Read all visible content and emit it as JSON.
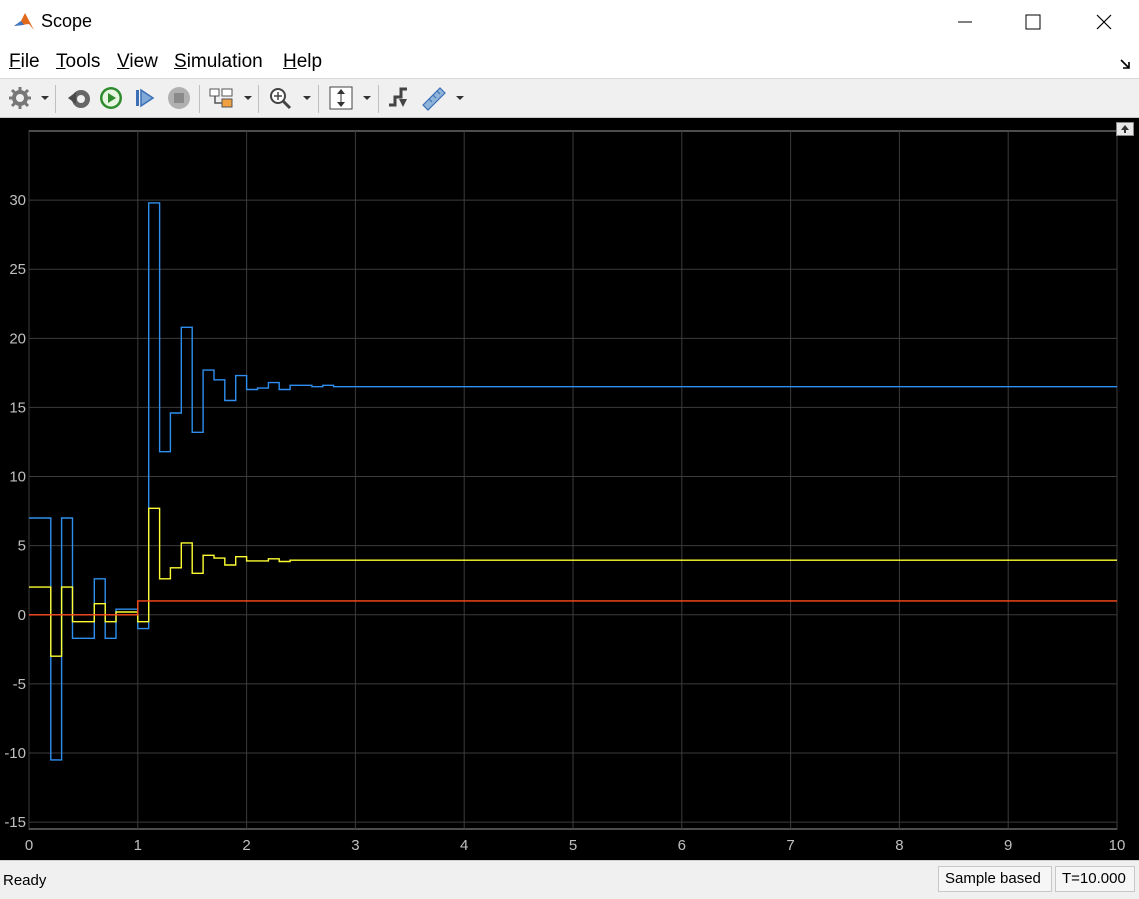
{
  "window": {
    "title": "Scope"
  },
  "menu": [
    "File",
    "Tools",
    "View",
    "Simulation",
    "Help"
  ],
  "toolbar": {
    "icons": [
      "gear-icon",
      "run-back-icon",
      "run-icon",
      "step-forward-icon",
      "stop-icon",
      "highlight-block-icon",
      "zoom-icon",
      "autoscale-icon",
      "signal-select-icon",
      "measure-icon"
    ]
  },
  "status": {
    "text": "Ready",
    "mode": "Sample based",
    "time": "T=10.000"
  },
  "colors": {
    "background": "#000000",
    "grid": "#3c3c3c",
    "axis_text": "#c0c0c0",
    "series1": "#ffff33",
    "series2": "#2e8ff0",
    "series3": "#ff4b1e"
  },
  "chart_data": {
    "type": "line",
    "step": true,
    "xlim": [
      0,
      10
    ],
    "ylim": [
      -15.5,
      35
    ],
    "xticks": [
      0,
      1,
      2,
      3,
      4,
      5,
      6,
      7,
      8,
      9,
      10
    ],
    "yticks": [
      -15,
      -10,
      -5,
      0,
      5,
      10,
      15,
      20,
      25,
      30
    ],
    "grid": true,
    "series": [
      {
        "color": "#2e8ff0",
        "points": [
          [
            0,
            7
          ],
          [
            0.2,
            7
          ],
          [
            0.2,
            -10.5
          ],
          [
            0.3,
            -10.5
          ],
          [
            0.3,
            7
          ],
          [
            0.4,
            7
          ],
          [
            0.4,
            -1.7
          ],
          [
            0.6,
            -1.7
          ],
          [
            0.6,
            2.6
          ],
          [
            0.7,
            2.6
          ],
          [
            0.7,
            -1.7
          ],
          [
            0.8,
            -1.7
          ],
          [
            0.8,
            0.4
          ],
          [
            1.0,
            0.4
          ],
          [
            1.0,
            -1.0
          ],
          [
            1.1,
            -1.0
          ],
          [
            1.1,
            29.8
          ],
          [
            1.2,
            29.8
          ],
          [
            1.2,
            11.8
          ],
          [
            1.3,
            11.8
          ],
          [
            1.3,
            14.6
          ],
          [
            1.4,
            14.6
          ],
          [
            1.4,
            20.8
          ],
          [
            1.5,
            20.8
          ],
          [
            1.5,
            13.2
          ],
          [
            1.6,
            13.2
          ],
          [
            1.6,
            17.7
          ],
          [
            1.7,
            17.7
          ],
          [
            1.7,
            17.0
          ],
          [
            1.8,
            17.0
          ],
          [
            1.8,
            15.5
          ],
          [
            1.9,
            15.5
          ],
          [
            1.9,
            17.3
          ],
          [
            2.0,
            17.3
          ],
          [
            2.0,
            16.3
          ],
          [
            2.1,
            16.3
          ],
          [
            2.1,
            16.4
          ],
          [
            2.2,
            16.4
          ],
          [
            2.2,
            16.8
          ],
          [
            2.3,
            16.8
          ],
          [
            2.3,
            16.3
          ],
          [
            2.4,
            16.3
          ],
          [
            2.4,
            16.6
          ],
          [
            2.5,
            16.6
          ],
          [
            2.5,
            16.6
          ],
          [
            2.6,
            16.6
          ],
          [
            2.6,
            16.5
          ],
          [
            2.7,
            16.5
          ],
          [
            2.7,
            16.6
          ],
          [
            2.8,
            16.6
          ],
          [
            2.8,
            16.5
          ],
          [
            10,
            16.5
          ]
        ]
      },
      {
        "color": "#ffff33",
        "points": [
          [
            0,
            2
          ],
          [
            0.2,
            2
          ],
          [
            0.2,
            -3
          ],
          [
            0.3,
            -3
          ],
          [
            0.3,
            2
          ],
          [
            0.4,
            2
          ],
          [
            0.4,
            -0.5
          ],
          [
            0.6,
            -0.5
          ],
          [
            0.6,
            0.8
          ],
          [
            0.7,
            0.8
          ],
          [
            0.7,
            -0.5
          ],
          [
            0.8,
            -0.5
          ],
          [
            0.8,
            0.2
          ],
          [
            1.0,
            0.2
          ],
          [
            1.0,
            -0.5
          ],
          [
            1.1,
            -0.5
          ],
          [
            1.1,
            7.7
          ],
          [
            1.2,
            7.7
          ],
          [
            1.2,
            2.6
          ],
          [
            1.3,
            2.6
          ],
          [
            1.3,
            3.4
          ],
          [
            1.4,
            3.4
          ],
          [
            1.4,
            5.2
          ],
          [
            1.5,
            5.2
          ],
          [
            1.5,
            3.0
          ],
          [
            1.6,
            3.0
          ],
          [
            1.6,
            4.3
          ],
          [
            1.7,
            4.3
          ],
          [
            1.7,
            4.1
          ],
          [
            1.8,
            4.1
          ],
          [
            1.8,
            3.6
          ],
          [
            1.9,
            3.6
          ],
          [
            1.9,
            4.2
          ],
          [
            2.0,
            4.2
          ],
          [
            2.0,
            3.9
          ],
          [
            2.2,
            3.9
          ],
          [
            2.2,
            4.05
          ],
          [
            2.3,
            4.05
          ],
          [
            2.3,
            3.85
          ],
          [
            2.4,
            3.85
          ],
          [
            2.4,
            3.95
          ],
          [
            10,
            3.95
          ]
        ]
      },
      {
        "color": "#ff4b1e",
        "points": [
          [
            0,
            0
          ],
          [
            1.0,
            0
          ],
          [
            1.0,
            1.0
          ],
          [
            10,
            1.0
          ]
        ]
      }
    ]
  }
}
